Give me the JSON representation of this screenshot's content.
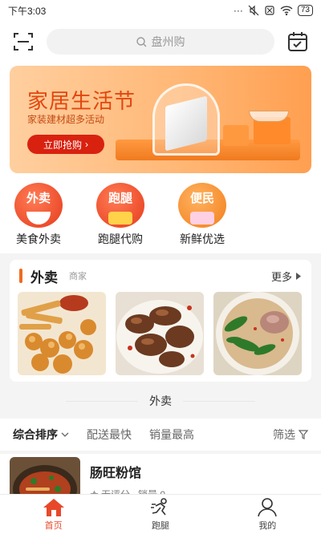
{
  "status": {
    "time": "下午3:03",
    "battery": "73"
  },
  "search": {
    "placeholder": "盘州购"
  },
  "banner": {
    "title": "家居生活节",
    "subtitle": "家装建材超多活动",
    "cta": "立即抢购"
  },
  "quick_links": [
    {
      "badge": "外卖",
      "label": "美食外卖"
    },
    {
      "badge": "跑腿",
      "label": "跑腿代购"
    },
    {
      "badge": "便民",
      "label": "新鲜优选"
    }
  ],
  "section": {
    "title": "外卖",
    "subtitle": "商家",
    "more": "更多"
  },
  "divider": "外卖",
  "sort": {
    "items": [
      "综合排序",
      "配送最快",
      "销量最高"
    ],
    "filter": "筛选"
  },
  "shop": {
    "name": "肠旺粉馆",
    "rating": "无评分",
    "sales": "销量 0"
  },
  "tabs": [
    {
      "label": "首页"
    },
    {
      "label": "跑腿"
    },
    {
      "label": "我的"
    }
  ],
  "colors": {
    "accent": "#e8482a",
    "orange": "#ef6b1f"
  }
}
